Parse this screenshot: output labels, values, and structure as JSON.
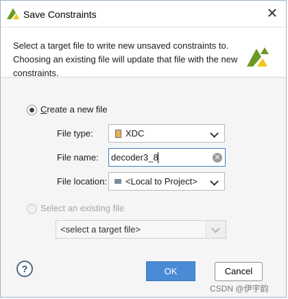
{
  "window": {
    "title": "Save Constraints",
    "close_glyph": "✕"
  },
  "header": {
    "description": "Select a target file to write new unsaved constraints to. Choosing an existing file will update that file with the new constraints."
  },
  "options": {
    "create_new": {
      "label": "Create a new file",
      "selected": true,
      "file_type": {
        "label": "File type:",
        "value": "XDC"
      },
      "file_name": {
        "label": "File name:",
        "value": "decoder3_8"
      },
      "file_location": {
        "label": "File location:",
        "value": "<Local to Project>"
      }
    },
    "select_existing": {
      "label": "Select an existing file",
      "selected": false,
      "placeholder": "<select a target file>"
    }
  },
  "buttons": {
    "help": "?",
    "ok": "OK",
    "cancel": "Cancel"
  },
  "watermark": "CSDN @伊宇韵",
  "colors": {
    "primary": "#4a8bd6",
    "logo_green": "#6a9a23",
    "logo_yellow": "#f2c418"
  },
  "icons": [
    "vivado-logo-icon",
    "close-icon",
    "xdc-file-icon",
    "folder-icon",
    "clear-icon",
    "chevron-down-icon",
    "help-icon"
  ]
}
